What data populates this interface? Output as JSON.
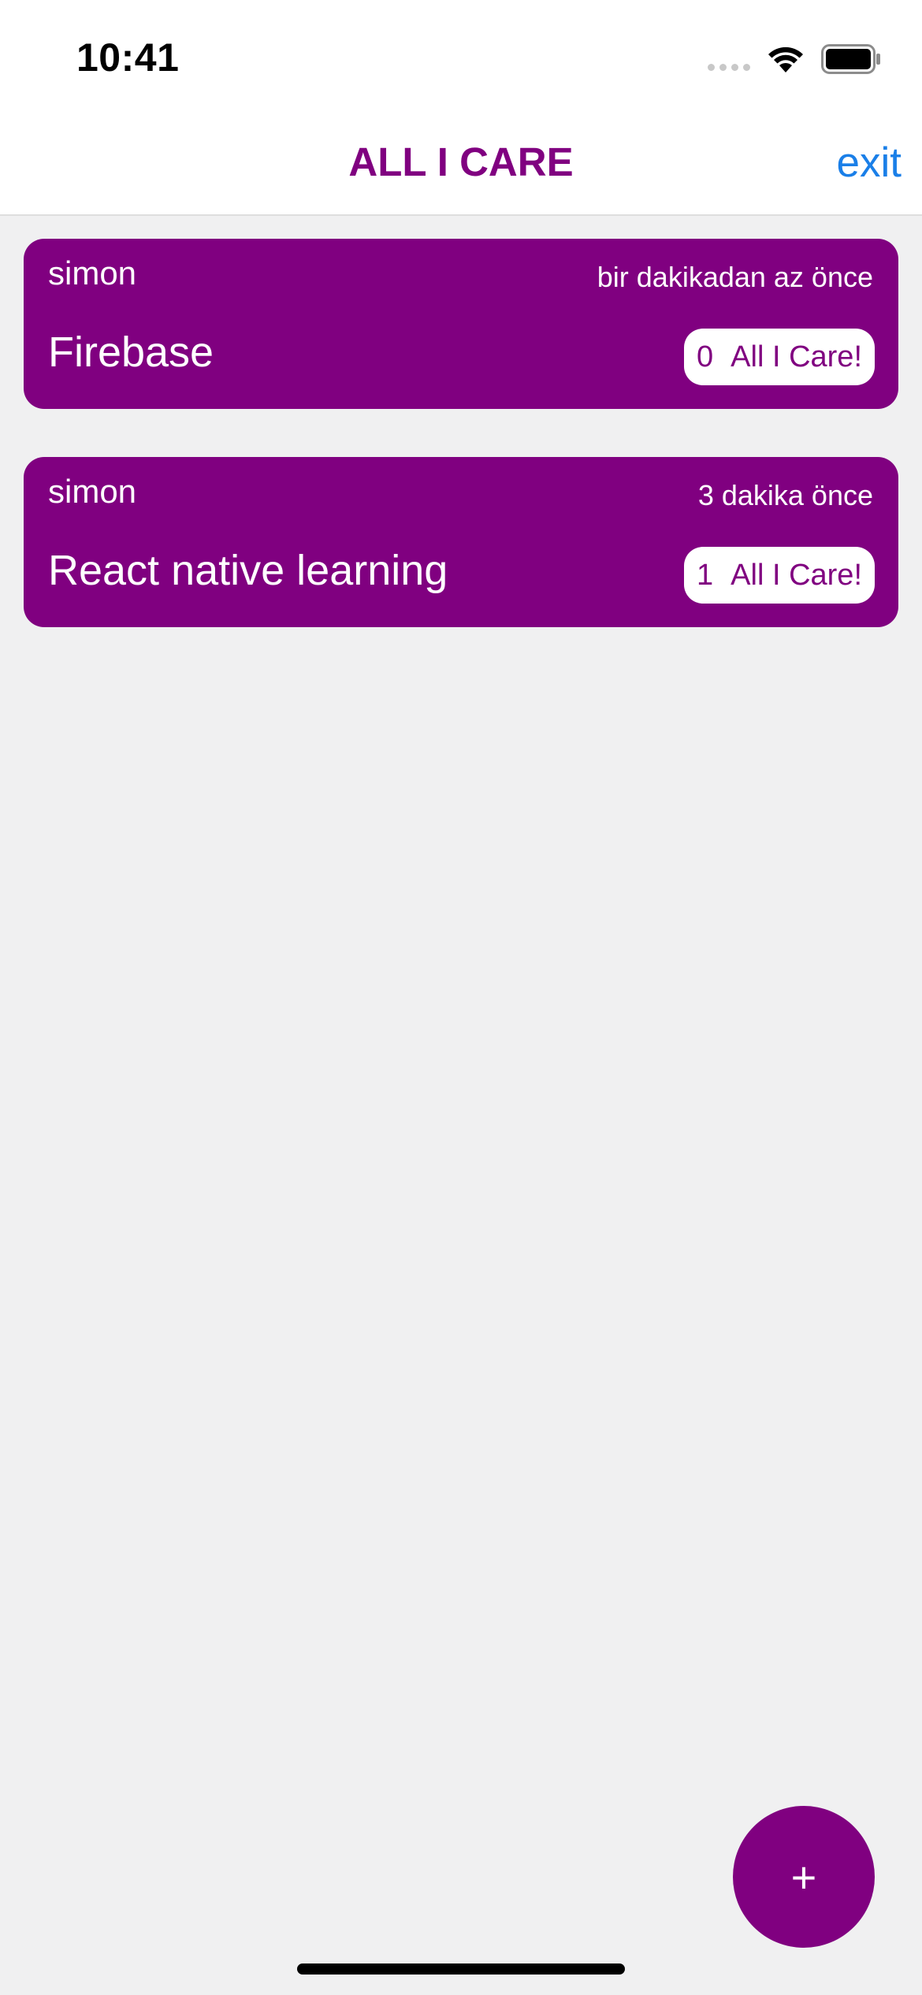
{
  "status_bar": {
    "time": "10:41",
    "icons": [
      "signal-icon",
      "wifi-icon",
      "battery-icon"
    ]
  },
  "header": {
    "title": "ALL I CARE",
    "exit_label": "exit"
  },
  "posts": [
    {
      "user": "simon",
      "time": "bir dakikadan az önce",
      "text": "Firebase",
      "care_count": "0",
      "care_label": "All I Care!"
    },
    {
      "user": "simon",
      "time": "3 dakika önce",
      "text": "React native learning",
      "care_count": "1",
      "care_label": "All I Care!"
    }
  ],
  "fab": {
    "label": "+"
  },
  "colors": {
    "accent": "#800080",
    "link": "#1a7fe8",
    "background": "#f0f0f1"
  }
}
